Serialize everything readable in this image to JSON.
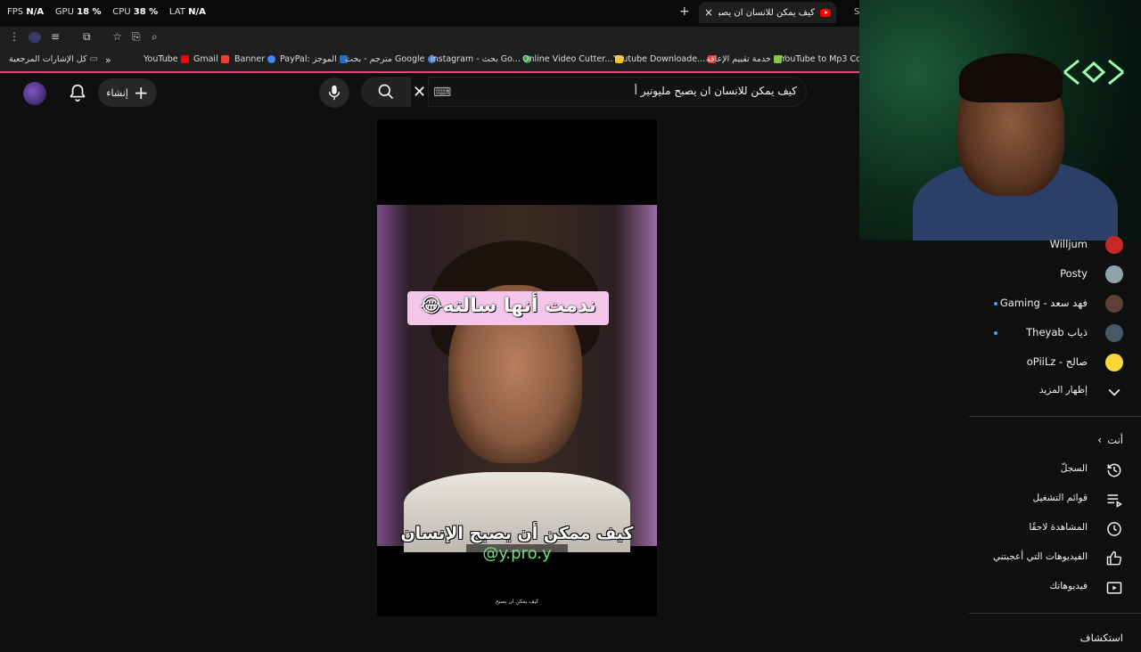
{
  "hud": {
    "fps_label": "FPS",
    "fps_value": "N/A",
    "gpu_label": "GPU",
    "gpu_value": "18 %",
    "cpu_label": "CPU",
    "cpu_value": "38 %",
    "lat_label": "LAT",
    "lat_value": "N/A"
  },
  "tab": {
    "title": "كيف يمكن للانسان ان يصبح",
    "close": "×",
    "new_tab": "+",
    "next_tab": "S"
  },
  "bookmarks": {
    "all_label": "كل الإشارات المرجعية",
    "overflow": "»",
    "items": [
      {
        "label": "YouTube",
        "color": "#ff0000"
      },
      {
        "label": "Gmail",
        "color": "#ea4335"
      },
      {
        "label": "Banner",
        "color": "#4285f4"
      },
      {
        "label": "PayPal: الموجز",
        "color": "#1f6fd1"
      },
      {
        "label": "مترجم - بحث Google",
        "color": "#4285f4"
      },
      {
        "label": "instagram - بحث Go...",
        "color": "#34a853"
      },
      {
        "label": "Online Video Cutter...",
        "color": "#fbbc05"
      },
      {
        "label": "Youtube Downloade...",
        "color": "#e53935"
      },
      {
        "label": "خدمة تقييم الإعاقة",
        "color": "#8bc34a"
      },
      {
        "label": "YouTube to Mp3 Co...",
        "color": "#3f51b5"
      }
    ]
  },
  "header": {
    "search_value": "كيف يمكن للانسان ان يصبح مليونير أ",
    "create_label": "إنشاء"
  },
  "video": {
    "caption_top": "ندمت أنها سالته😂",
    "caption_bottom": "كيف ممكن أن يصبح الإنسان",
    "handle": "@y.pro.y",
    "footer": "كيف يمكن ان يصبح"
  },
  "subscriptions": [
    {
      "name": "Willjum",
      "color": "#c62828",
      "dot": false
    },
    {
      "name": "Posty",
      "color": "#90a4ae",
      "dot": false
    },
    {
      "name": "فهد سعد - Gaming",
      "color": "#5d4037",
      "dot": true
    },
    {
      "name": "ذياب Theyab",
      "color": "#455a64",
      "dot": true
    },
    {
      "name": "صالح - oPiiLz",
      "color": "#fdd835",
      "dot": false
    }
  ],
  "show_more": "إظهار المزيد",
  "you_section": {
    "title": "أنت",
    "items": [
      "السجلّ",
      "قوائم التشغيل",
      "المشاهدة لاحقًا",
      "الفيديوهات التي أعجبتني",
      "فيديوهاتك"
    ]
  },
  "explore_title": "استكشاف"
}
